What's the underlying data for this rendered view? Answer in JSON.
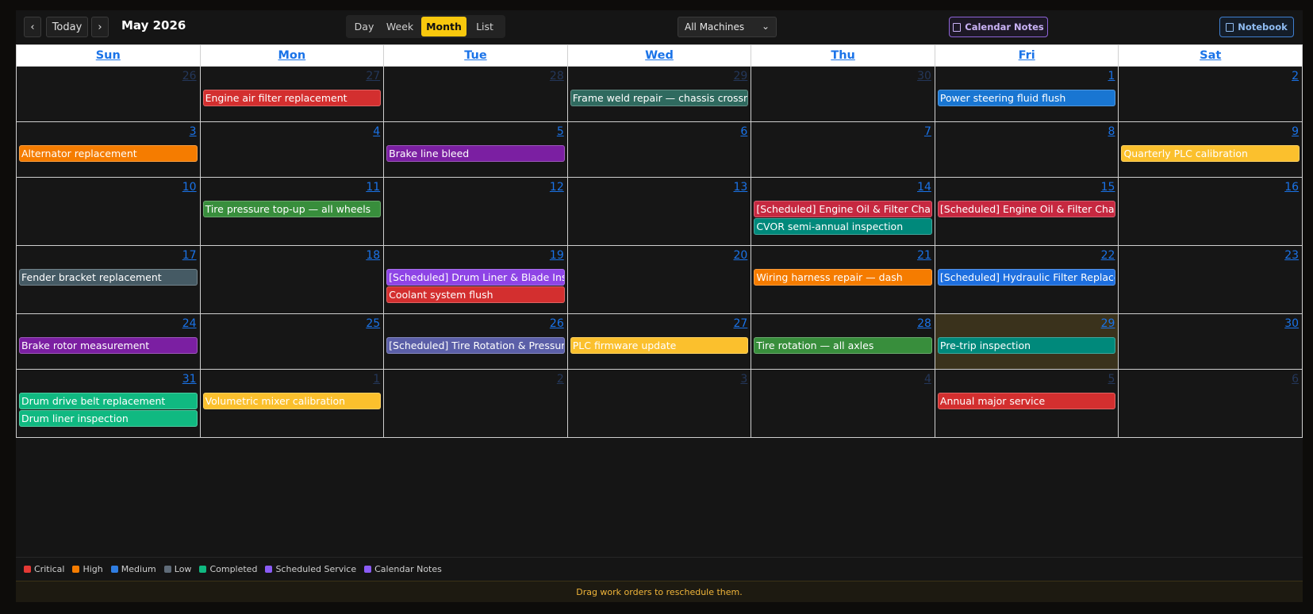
{
  "toolbar": {
    "prev": "‹",
    "today": "Today",
    "next": "›",
    "title": "May 2026",
    "views": [
      "Day",
      "Week",
      "Month",
      "List"
    ],
    "active_view": "Month",
    "machine_filter": "All Machines",
    "calendar_notes_label": "Calendar Notes",
    "notebook_label": "Notebook"
  },
  "weekdays": [
    "Sun",
    "Mon",
    "Tue",
    "Wed",
    "Thu",
    "Fri",
    "Sat"
  ],
  "weeks": [
    {
      "days": [
        {
          "n": "26",
          "other": true,
          "events": []
        },
        {
          "n": "27",
          "other": true,
          "events": [
            {
              "t": "Engine air filter replacement",
              "c": "#d32f2f"
            }
          ]
        },
        {
          "n": "28",
          "other": true,
          "events": []
        },
        {
          "n": "29",
          "other": true,
          "events": [
            {
              "t": "Frame weld repair — chassis crossmember",
              "c": "#2f6a5f"
            }
          ]
        },
        {
          "n": "30",
          "other": true,
          "events": []
        },
        {
          "n": "1",
          "events": [
            {
              "t": "Power steering fluid flush",
              "c": "#1976d2"
            }
          ]
        },
        {
          "n": "2",
          "events": []
        }
      ]
    },
    {
      "days": [
        {
          "n": "3",
          "events": [
            {
              "t": "Alternator replacement",
              "c": "#f57c00"
            }
          ]
        },
        {
          "n": "4",
          "events": []
        },
        {
          "n": "5",
          "events": [
            {
              "t": "Brake line bleed",
              "c": "#7b1fa2"
            }
          ]
        },
        {
          "n": "6",
          "events": []
        },
        {
          "n": "7",
          "events": []
        },
        {
          "n": "8",
          "events": []
        },
        {
          "n": "9",
          "events": [
            {
              "t": "Quarterly PLC calibration",
              "c": "#fbc02d"
            }
          ]
        }
      ]
    },
    {
      "days": [
        {
          "n": "10",
          "events": []
        },
        {
          "n": "11",
          "events": [
            {
              "t": "Tire pressure top-up — all wheels",
              "c": "#388e3c"
            }
          ]
        },
        {
          "n": "12",
          "events": []
        },
        {
          "n": "13",
          "events": []
        },
        {
          "n": "14",
          "events": [
            {
              "t": "[Scheduled] Engine Oil & Filter Change",
              "c": "#c62840"
            },
            {
              "t": "CVOR semi-annual inspection",
              "c": "#00897b"
            }
          ]
        },
        {
          "n": "15",
          "events": [
            {
              "t": "[Scheduled] Engine Oil & Filter Change",
              "c": "#c62840"
            }
          ]
        },
        {
          "n": "16",
          "events": []
        }
      ]
    },
    {
      "days": [
        {
          "n": "17",
          "events": [
            {
              "t": "Fender bracket replacement",
              "c": "#455a64"
            }
          ]
        },
        {
          "n": "18",
          "events": []
        },
        {
          "n": "19",
          "events": [
            {
              "t": "[Scheduled] Drum Liner & Blade Inspection",
              "c": "#8e44e6"
            },
            {
              "t": "Coolant system flush",
              "c": "#d32f2f"
            }
          ]
        },
        {
          "n": "20",
          "events": []
        },
        {
          "n": "21",
          "events": [
            {
              "t": "Wiring harness repair — dash",
              "c": "#f57c00"
            }
          ]
        },
        {
          "n": "22",
          "events": [
            {
              "t": "[Scheduled] Hydraulic Filter Replacement",
              "c": "#1e6fdf"
            }
          ]
        },
        {
          "n": "23",
          "events": []
        }
      ]
    },
    {
      "days": [
        {
          "n": "24",
          "events": [
            {
              "t": "Brake rotor measurement",
              "c": "#7b1fa2"
            }
          ]
        },
        {
          "n": "25",
          "events": []
        },
        {
          "n": "26",
          "events": [
            {
              "t": "[Scheduled] Tire Rotation & Pressure Check",
              "c": "#5b5fa8"
            }
          ]
        },
        {
          "n": "27",
          "events": [
            {
              "t": "PLC firmware update",
              "c": "#fbc02d"
            }
          ]
        },
        {
          "n": "28",
          "events": [
            {
              "t": "Tire rotation — all axles",
              "c": "#388e3c"
            }
          ]
        },
        {
          "n": "29",
          "today": true,
          "events": [
            {
              "t": "Pre-trip inspection",
              "c": "#00897b"
            }
          ]
        },
        {
          "n": "30",
          "events": []
        }
      ]
    },
    {
      "days": [
        {
          "n": "31",
          "events": [
            {
              "t": "Drum drive belt replacement",
              "c": "#10b981"
            },
            {
              "t": "Drum liner inspection",
              "c": "#10b981"
            }
          ]
        },
        {
          "n": "1",
          "other": true,
          "events": [
            {
              "t": "Volumetric mixer calibration",
              "c": "#fbc02d"
            }
          ]
        },
        {
          "n": "2",
          "other": true,
          "events": []
        },
        {
          "n": "3",
          "other": true,
          "events": []
        },
        {
          "n": "4",
          "other": true,
          "events": []
        },
        {
          "n": "5",
          "other": true,
          "events": [
            {
              "t": "Annual major service",
              "c": "#d32f2f"
            }
          ]
        },
        {
          "n": "6",
          "other": true,
          "events": []
        }
      ]
    }
  ],
  "legend": [
    {
      "label": "Critical",
      "color": "#e53935"
    },
    {
      "label": "High",
      "color": "#f57c00"
    },
    {
      "label": "Medium",
      "color": "#2f7de1"
    },
    {
      "label": "Low",
      "color": "#5f6b78"
    },
    {
      "label": "Completed",
      "color": "#10b981"
    },
    {
      "label": "Scheduled Service",
      "color": "#8b5cf6"
    },
    {
      "label": "Calendar Notes",
      "color": "#8b5cf6"
    }
  ],
  "footer_hint": "Drag work orders to reschedule them."
}
